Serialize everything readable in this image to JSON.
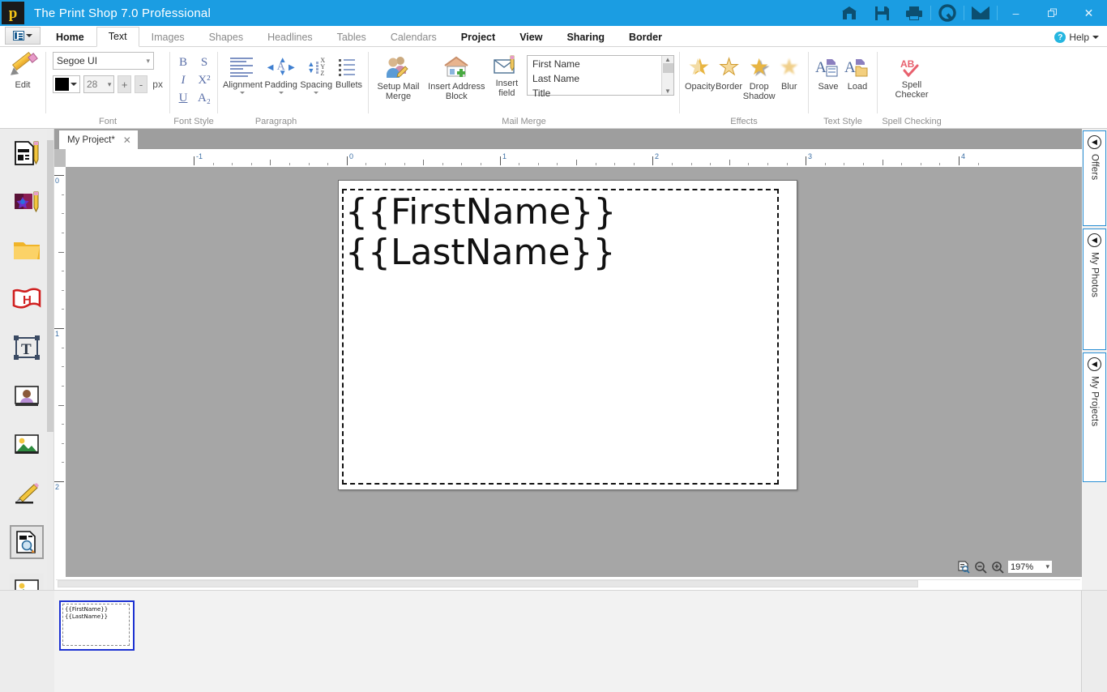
{
  "titlebar": {
    "app_name": "The Print Shop 7.0 Professional",
    "logo_letter": "p",
    "icons": [
      "store-icon",
      "save-icon",
      "print-icon",
      "quicktime-icon",
      "mail-icon"
    ],
    "window_controls": {
      "minimize": "–",
      "restore": "❐",
      "close": "✕"
    }
  },
  "ribbon_tabs": {
    "quick_access_label": "quick-access-menu",
    "items": [
      {
        "label": "Home",
        "state": "strong"
      },
      {
        "label": "Text",
        "state": "active"
      },
      {
        "label": "Images",
        "state": "normal"
      },
      {
        "label": "Shapes",
        "state": "normal"
      },
      {
        "label": "Headlines",
        "state": "normal"
      },
      {
        "label": "Tables",
        "state": "normal"
      },
      {
        "label": "Calendars",
        "state": "normal"
      },
      {
        "label": "Project",
        "state": "dark"
      },
      {
        "label": "View",
        "state": "dark"
      },
      {
        "label": "Sharing",
        "state": "dark"
      },
      {
        "label": "Border",
        "state": "dark"
      }
    ],
    "help": {
      "label": "Help",
      "badge": "?"
    }
  },
  "ribbon": {
    "edit": {
      "label": "Edit"
    },
    "font": {
      "group_label": "Font",
      "font_name": "Segoe UI",
      "color_value": "#000000",
      "size_value": "28",
      "plus": "+",
      "minus": "-",
      "unit": "px"
    },
    "font_style": {
      "group_label": "Font Style",
      "buttons": [
        "B",
        "S",
        "I",
        "X²",
        "U",
        "A₂"
      ]
    },
    "paragraph": {
      "group_label": "Paragraph",
      "buttons": [
        {
          "label": "Alignment",
          "icon": "alignment-icon"
        },
        {
          "label": "Padding",
          "icon": "padding-icon"
        },
        {
          "label": "Spacing",
          "icon": "spacing-icon"
        },
        {
          "label": "Bullets",
          "icon": "bullets-icon"
        }
      ]
    },
    "mail_merge": {
      "group_label": "Mail Merge",
      "buttons": [
        {
          "label": "Setup Mail Merge",
          "icon": "people-edit-icon"
        },
        {
          "label": "Insert Address Block",
          "icon": "house-plus-icon"
        },
        {
          "label": "Insert field",
          "icon": "envelope-pencil-icon"
        }
      ],
      "field_list": [
        "First Name",
        "Last Name",
        "Title"
      ]
    },
    "effects": {
      "group_label": "Effects",
      "buttons": [
        {
          "label": "Opacity",
          "icon": "star-half-icon"
        },
        {
          "label": "Border",
          "icon": "star-outline-icon"
        },
        {
          "label": "Drop Shadow",
          "icon": "star-shadow-icon"
        },
        {
          "label": "Blur",
          "icon": "star-blur-icon"
        }
      ]
    },
    "text_style": {
      "group_label": "Text Style",
      "buttons": [
        {
          "label": "Save",
          "icon": "text-style-save-icon"
        },
        {
          "label": "Load",
          "icon": "text-style-load-icon"
        }
      ]
    },
    "spell_checking": {
      "group_label": "Spell Checking",
      "buttons": [
        {
          "label": "Spell Checker",
          "icon": "abc-check-icon"
        }
      ]
    }
  },
  "left_tools": [
    {
      "name": "new-project-tool",
      "icon": "document-pencil-icon"
    },
    {
      "name": "greeting-card-tool",
      "icon": "card-pencil-icon"
    },
    {
      "name": "open-project-tool",
      "icon": "folder-icon"
    },
    {
      "name": "headline-tool",
      "icon": "banner-h-icon"
    },
    {
      "name": "text-tool",
      "icon": "text-frame-icon"
    },
    {
      "name": "portrait-tool",
      "icon": "photo-person-icon"
    },
    {
      "name": "image-tool",
      "icon": "picture-icon"
    },
    {
      "name": "draw-tool",
      "icon": "pencil-line-icon"
    },
    {
      "name": "preview-tool",
      "icon": "document-magnifier-icon",
      "selected": true
    },
    {
      "name": "print-preview-tool",
      "icon": "picture-red-icon",
      "sub": true
    }
  ],
  "document": {
    "tab_label": "My Project*",
    "tab_close": "✕",
    "canvas_text": [
      "{{FirstName}}",
      "{{LastName}}"
    ],
    "ruler_h_labels": [
      "-1",
      "0",
      "1",
      "2",
      "3",
      "4"
    ],
    "ruler_v_labels": [
      "0",
      "1",
      "2"
    ],
    "zoom_value": "197%",
    "zoom_icons": [
      "fit-page-icon",
      "zoom-out-icon",
      "zoom-in-icon"
    ]
  },
  "right_panels": [
    {
      "label": "Offers",
      "icon": "chevron-left-icon"
    },
    {
      "label": "My Photos",
      "icon": "chevron-left-icon"
    },
    {
      "label": "My Projects",
      "icon": "chevron-left-icon"
    }
  ],
  "thumbnail": {
    "lines": [
      "{{FirstName}}",
      "{{LastName}}"
    ]
  },
  "colors": {
    "title_bar": "#1b9de2",
    "canvas_bg": "#a6a6a6",
    "accent_blue": "#2a8fd4",
    "selection_blue": "#1d32d2"
  }
}
